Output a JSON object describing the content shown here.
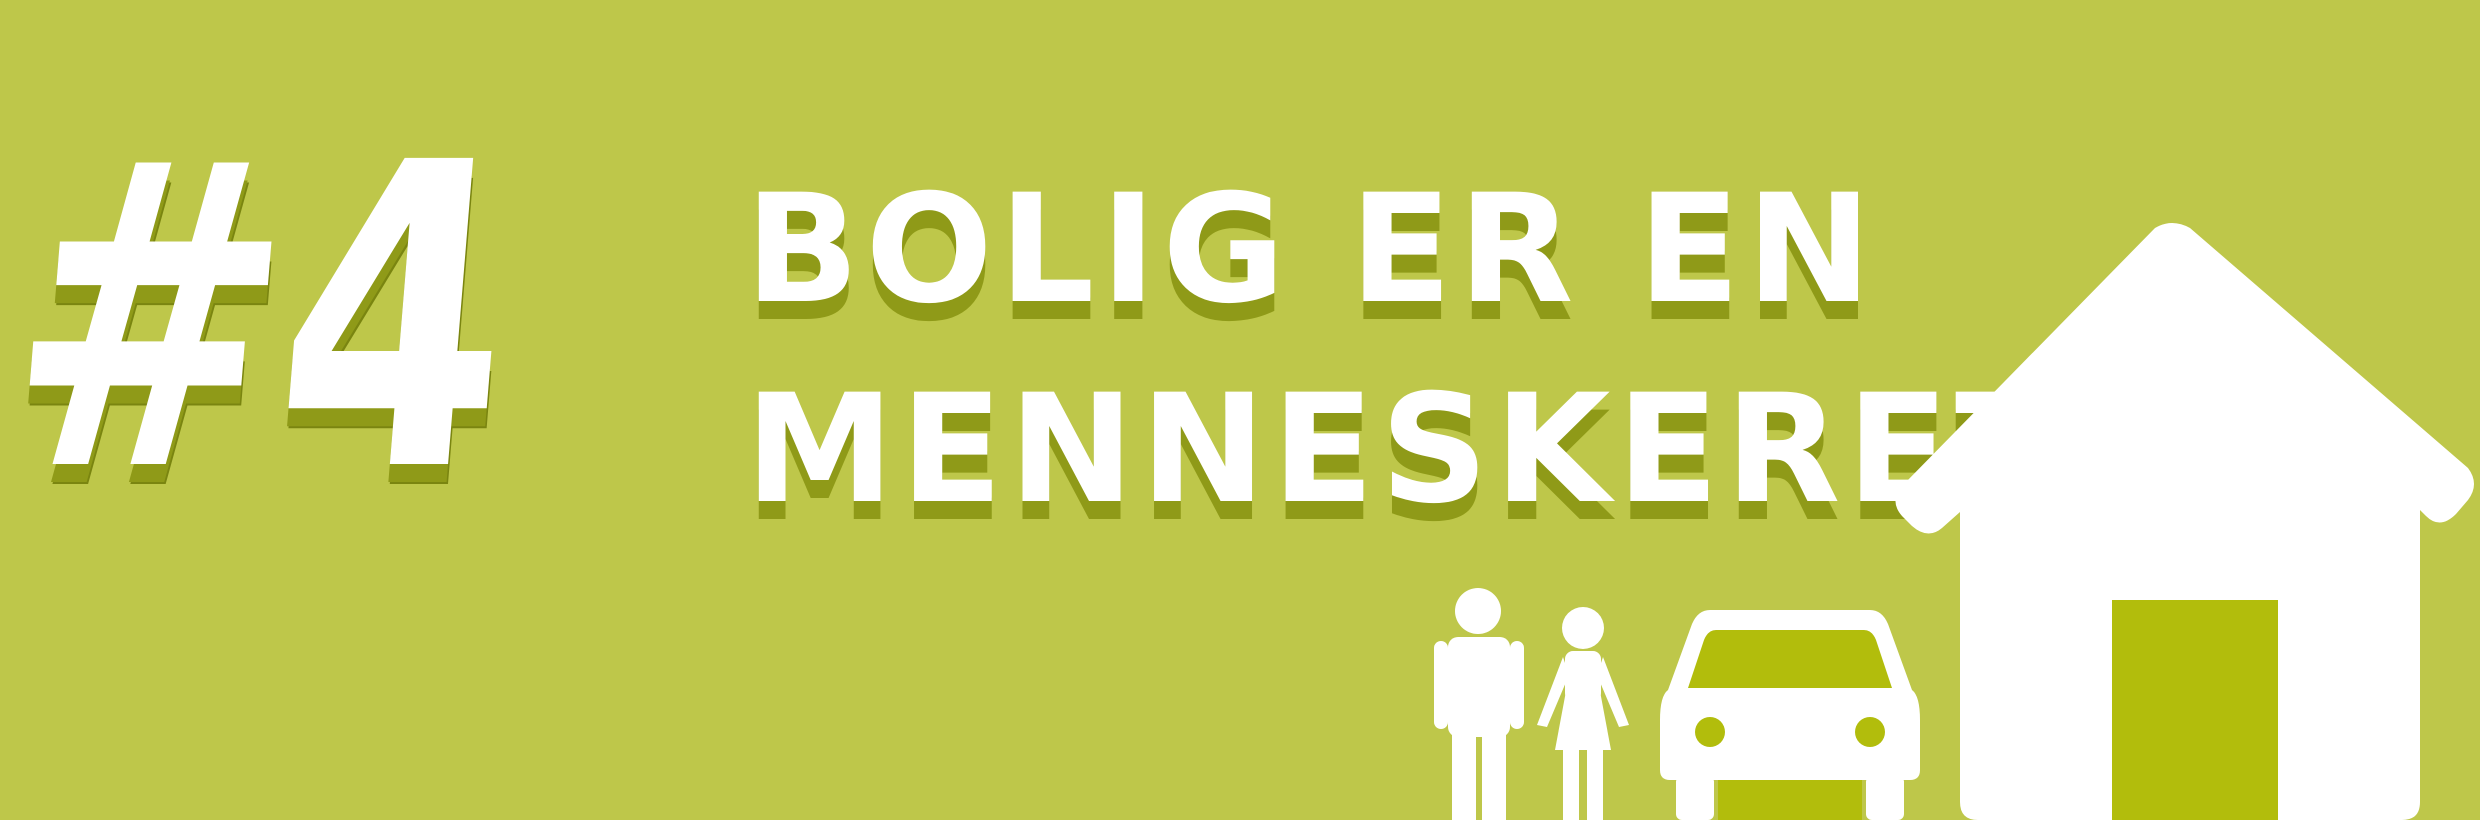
{
  "hero": {
    "number": "#4",
    "headline_line1": "BOLIG ER EN",
    "headline_line2": "MENNESKERET"
  },
  "icons": {
    "man": "man-icon",
    "woman": "woman-icon",
    "car": "car-icon",
    "house": "house-icon"
  },
  "colors": {
    "background": "#bec74a",
    "foreground": "#ffffff",
    "accent": "#b2bd0c",
    "shadow": "#8f9a18"
  }
}
